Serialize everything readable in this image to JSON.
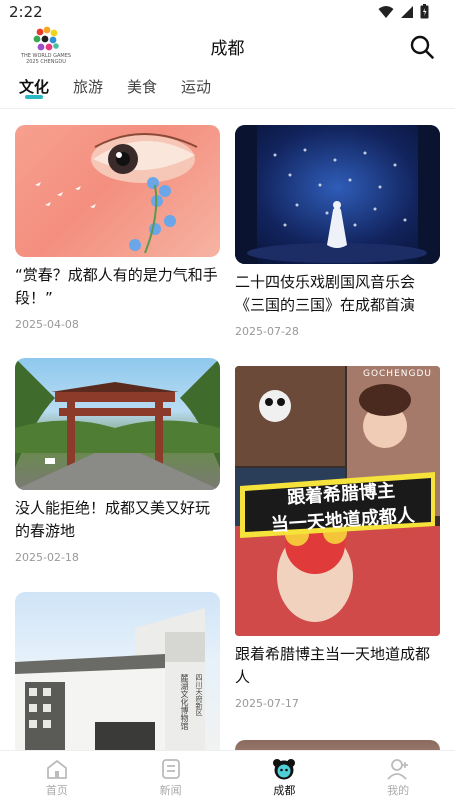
{
  "status_bar": {
    "time": "2:22"
  },
  "header": {
    "title": "成都",
    "logo_text": "THE WORLD GAMES 2025 CHENGDU"
  },
  "tabs": [
    {
      "label": "文化",
      "active": true
    },
    {
      "label": "旅游",
      "active": false
    },
    {
      "label": "美食",
      "active": false
    },
    {
      "label": "运动",
      "active": false
    }
  ],
  "cards": [
    {
      "title": "“赏春？成都人有的是力气和手段！”",
      "date": "2025-04-08"
    },
    {
      "title": "二十四伎乐戏剧国风音乐会《三国的三国》在成都首演",
      "date": "2025-07-28"
    },
    {
      "title": "没人能拒绝！成都又美又好玩的春游地",
      "date": "2025-02-18"
    },
    {
      "title": "跟着希腊博主当一天地道成都人",
      "date": "2025-07-17",
      "image_text": [
        "跟着希腊博主",
        "当一天地道成都人"
      ],
      "watermark": "GOCHENGDU"
    },
    {
      "title": "",
      "date": "",
      "image_text": [
        "四川天府新区",
        "麓湖文化博物馆"
      ]
    }
  ],
  "bottom_nav": [
    {
      "label": "首页",
      "icon": "home-icon",
      "active": false
    },
    {
      "label": "新闻",
      "icon": "news-icon",
      "active": false
    },
    {
      "label": "成都",
      "icon": "panda-icon",
      "active": true
    },
    {
      "label": "我的",
      "icon": "profile-icon",
      "active": false
    }
  ],
  "colors": {
    "accent": "#2bb8c4",
    "text": "#111111",
    "muted": "#999999",
    "nav_inactive": "#aaaaaa"
  }
}
